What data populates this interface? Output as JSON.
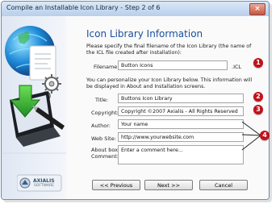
{
  "window": {
    "title": "Compile an Installable Icon Library - Step 2 of 6",
    "close_symbol": "×"
  },
  "header": {
    "heading": "Icon Library Information",
    "filename_hint": "Please specify the final filename of the Icon Library (the name of the ICL file created after installation):"
  },
  "filename": {
    "label": "Filename:",
    "value": "Button Icons",
    "extension": ".ICL"
  },
  "personalize": {
    "text": "You can personalize your Icon Library below. This information will be displayed in About and Installation screens."
  },
  "fields": {
    "title": {
      "label": "Title:",
      "value": "Buttons Icon Library"
    },
    "copyright": {
      "label": "Copyright:",
      "value": "Copyright ©2007 Axialis - All Rights Reserved"
    },
    "author": {
      "label": "Author:",
      "value": "Your name"
    },
    "website": {
      "label": "Web Site:",
      "value": "http://www.yourwebsite.com"
    },
    "about_label_1": "About box",
    "about_label_2": "Comment:",
    "about_value": "Enter a comment here..."
  },
  "buttons": {
    "previous": "<< Previous",
    "next": "Next >>",
    "cancel": "Cancel"
  },
  "badges": [
    "1",
    "2",
    "3",
    "4"
  ],
  "logo": {
    "brand": "AXIALIS",
    "sub": "SOFTWARE"
  },
  "icons": [
    "globe-icon",
    "document-icon",
    "download-arrow-icon",
    "monitor-icon",
    "gear-icon",
    "pen-icon",
    "axialis-logo-icon"
  ],
  "colors": {
    "heading": "#1c4f9c",
    "badge": "#c1121a",
    "title_bar": "#c8daf0"
  }
}
